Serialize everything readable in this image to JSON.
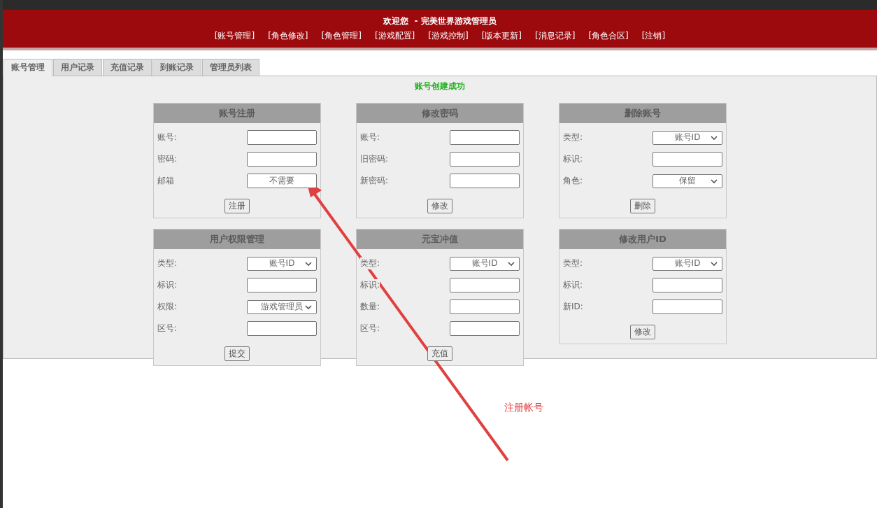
{
  "header": {
    "title": "欢迎您  - 完美世界游戏管理员",
    "nav": [
      "[账号管理]",
      "[角色修改]",
      "[角色管理]",
      "[游戏配置]",
      "[游戏控制]",
      "[版本更新]",
      "[消息记录]",
      "[角色合区]",
      "[注销]"
    ]
  },
  "tabs": [
    {
      "label": "账号管理",
      "selected": true
    },
    {
      "label": "用户记录",
      "selected": false
    },
    {
      "label": "充值记录",
      "selected": false
    },
    {
      "label": "到账记录",
      "selected": false
    },
    {
      "label": "管理员列表",
      "selected": false
    }
  ],
  "message": "账号创建成功",
  "panels": [
    {
      "title": "账号注册",
      "fields": [
        {
          "label": "账号:",
          "kind": "input"
        },
        {
          "label": "密码:",
          "kind": "input"
        },
        {
          "label": "邮箱",
          "kind": "input",
          "value": "不需要"
        }
      ],
      "button": "注册"
    },
    {
      "title": "修改密码",
      "fields": [
        {
          "label": "账号:",
          "kind": "input"
        },
        {
          "label": "旧密码:",
          "kind": "input"
        },
        {
          "label": "新密码:",
          "kind": "input"
        }
      ],
      "button": "修改"
    },
    {
      "title": "删除账号",
      "fields": [
        {
          "label": "类型:",
          "kind": "select",
          "value": "账号ID"
        },
        {
          "label": "标识:",
          "kind": "input"
        },
        {
          "label": "角色:",
          "kind": "select",
          "value": "保留"
        }
      ],
      "button": "删除"
    },
    {
      "title": "用户权限管理",
      "fields": [
        {
          "label": "类型:",
          "kind": "select",
          "value": "账号ID"
        },
        {
          "label": "标识:",
          "kind": "input"
        },
        {
          "label": "权限:",
          "kind": "select",
          "value": "游戏管理员"
        },
        {
          "label": "区号:",
          "kind": "input"
        }
      ],
      "button": "提交"
    },
    {
      "title": "元宝冲值",
      "fields": [
        {
          "label": "类型:",
          "kind": "select",
          "value": "账号ID"
        },
        {
          "label": "标识:",
          "kind": "input"
        },
        {
          "label": "数量:",
          "kind": "input"
        },
        {
          "label": "区号:",
          "kind": "input"
        }
      ],
      "button": "充值"
    },
    {
      "title": "修改用户ID",
      "fields": [
        {
          "label": "类型:",
          "kind": "select",
          "value": "账号ID"
        },
        {
          "label": "标识:",
          "kind": "input"
        },
        {
          "label": "新ID:",
          "kind": "input"
        }
      ],
      "button": "修改"
    }
  ],
  "annotation": {
    "text": "注册帐号"
  }
}
